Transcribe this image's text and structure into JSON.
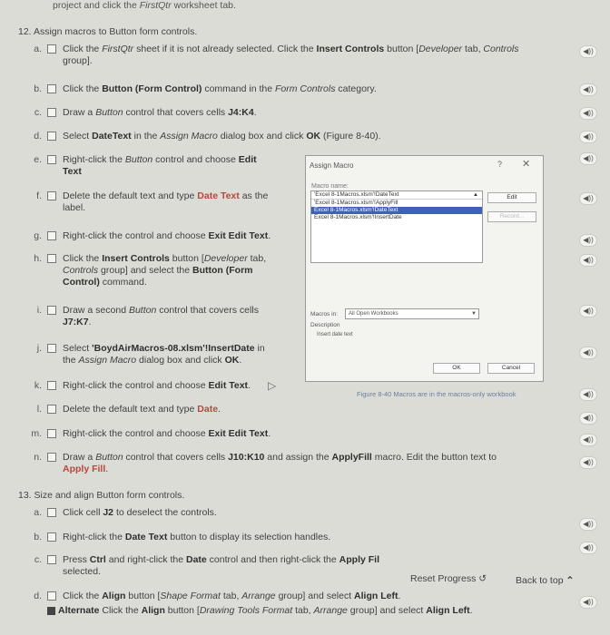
{
  "top_text": {
    "pre": "project and click the ",
    "italic": "FirstQtr",
    "post": " worksheet tab."
  },
  "section12": {
    "number": "12.",
    "title": "Assign macros to Button form controls."
  },
  "steps12": {
    "a": {
      "letter": "a.",
      "t1": "Click the ",
      "i1": "FirstQtr",
      "t2": " sheet if it is not already selected. Click the ",
      "b1": "Insert Controls",
      "t3": " button [",
      "i2": "Developer",
      "t4": " tab, ",
      "i3": "Controls",
      "t5": "",
      "line2": "group]."
    },
    "b": {
      "letter": "b.",
      "t1": "Click the ",
      "b1": "Button (Form Control)",
      "t2": " command in the ",
      "i1": "Form Controls",
      "t3": " category."
    },
    "c": {
      "letter": "c.",
      "t1": "Draw a ",
      "i1": "Button",
      "t2": " control that covers cells ",
      "b1": "J4:K4",
      "t3": "."
    },
    "d": {
      "letter": "d.",
      "t1": "Select ",
      "b1": "DateText",
      "t2": " in the ",
      "i1": "Assign Macro",
      "t3": " dialog box and click ",
      "b2": "OK",
      "t4": " (Figure 8-40)."
    },
    "e": {
      "letter": "e.",
      "t1": "Right-click the ",
      "i1": "Button",
      "t2": " control and choose ",
      "b1": "Edit",
      "line2": "Text",
      "t3": "."
    },
    "f": {
      "letter": "f.",
      "t1": "Delete the default text and type ",
      "r1": "Date Text",
      "t2": " as the",
      "line2": "label."
    },
    "g": {
      "letter": "g.",
      "t1": "Right-click the control and choose ",
      "b1": "Exit Edit Text",
      "t2": "."
    },
    "h": {
      "letter": "h.",
      "t1": "Click the ",
      "b1": "Insert Controls",
      "t2": " button [",
      "i1": "Developer",
      "t3": " tab,",
      "i2": "Controls",
      "t4": " group] and select the ",
      "b2": "Button (Form",
      "b3": "Control)",
      "t5": " command."
    },
    "i": {
      "letter": "i.",
      "t1": "Draw a second ",
      "i1": "Button",
      "t2": " control that covers cells",
      "b1": "J7:K7",
      "t3": "."
    },
    "j": {
      "letter": "j.",
      "t1": "Select ",
      "b1": "'BoydAirMacros-08.xlsm'!InsertDate",
      "t2": " in",
      "line2": "the ",
      "i1": "Assign Macro",
      "t3": " dialog box and click ",
      "b2": "OK",
      "t4": "."
    },
    "k": {
      "letter": "k.",
      "t1": "Right-click the control and choose ",
      "b1": "Edit Text",
      "t2": "."
    },
    "l": {
      "letter": "l.",
      "t1": "Delete the default text and type ",
      "r1": "Date",
      "t2": "."
    },
    "m": {
      "letter": "m.",
      "t1": "Right-click the control and choose ",
      "b1": "Exit Edit Text",
      "t2": "."
    },
    "n": {
      "letter": "n.",
      "t1": "Draw a ",
      "i1": "Button",
      "t2": " control that covers cells ",
      "b1": "J10:K10",
      "t3": " and assign the ",
      "b2": "ApplyFill",
      "t4": " macro. Edit the button text to",
      "r1": "Apply Fill",
      "t5": "."
    }
  },
  "section13": {
    "number": "13.",
    "title": "Size and align Button form controls."
  },
  "steps13": {
    "a": {
      "letter": "a.",
      "t1": "Click cell ",
      "b1": "J2",
      "t2": " to deselect the controls."
    },
    "b": {
      "letter": "b.",
      "t1": "Right-click the ",
      "b1": "Date Text",
      "t2": " button to display its selection handles."
    },
    "c": {
      "letter": "c.",
      "t1": "Press ",
      "b1": "Ctrl",
      "t2": " and right-click the ",
      "b2": "Date",
      "t3": " control and then right-click the ",
      "b3": "Apply Fil",
      "line2": "selected."
    },
    "d": {
      "letter": "d.",
      "t1": "Click the ",
      "b1": "Align",
      "t2": " button [",
      "i1": "Shape Format",
      "t3": " tab, ",
      "i2": "Arrange",
      "t4": " group] and select ",
      "b2": "Align Left",
      "t5": "."
    },
    "alt": {
      "label": "Alternate",
      "t1": " Click the ",
      "b1": "Align",
      "t2": " button [",
      "i1": "Drawing Tools Format",
      "t3": " tab, ",
      "i2": "Arrange",
      "t4": " group] and select ",
      "b2": "Align Left",
      "t5": "."
    }
  },
  "dialog": {
    "title": "Assign Macro",
    "help": "?",
    "close": "✕",
    "macro_name_label": "Macro name:",
    "macro_input": "'Excel 8-1Macros.xlsm'!DateText",
    "macros": [
      "'Excel 8-1Macros.xlsm'!ApplyFill",
      "Excel 8-1Macros.xlsm'!DateText",
      "Excel 8-1Macros.xlsm'!InsertDate"
    ],
    "selected_index": 1,
    "edit_label": "Edit",
    "record_label": "Record...",
    "macros_in_label": "Macros in:",
    "macros_in_value": "All Open Workbooks",
    "description_label": "Description",
    "description_text": "Insert date text",
    "ok_label": "OK",
    "cancel_label": "Cancel"
  },
  "figure_caption": "Figure 8-40 Macros are in the macros-only workbook",
  "nav": {
    "reset_label": "Reset Progress",
    "back_to_top_label": "Back to top"
  },
  "audio_label": "◀))"
}
